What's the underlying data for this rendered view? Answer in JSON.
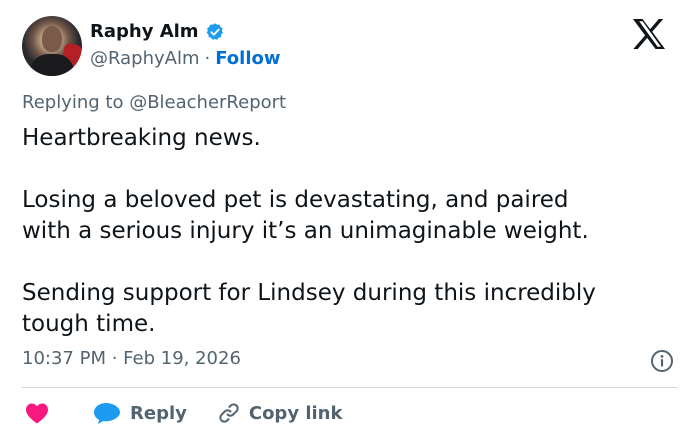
{
  "author": {
    "display_name": "Raphy Alm",
    "handle": "@RaphyAlm",
    "separator": "·",
    "follow_label": "Follow",
    "verified": true
  },
  "reply_to": "Replying to @BleacherReport",
  "tweet_text": "Heartbreaking news.\n\nLosing a beloved pet is devastating, and paired\nwith a serious injury it’s an unimaginable weight.\n\nSending support for Lindsey during this incredibly\ntough time.",
  "timestamp": "10:37 PM · Feb 19, 2026",
  "actions": {
    "reply_label": "Reply",
    "copy_link_label": "Copy link"
  },
  "colors": {
    "verified": "#1d9bf0",
    "follow": "#006fd6",
    "heart": "#f91880",
    "reply_bubble": "#1d9bf0",
    "muted": "#536471"
  },
  "icons": [
    "verified-badge-icon",
    "x-logo-icon",
    "info-icon",
    "heart-icon",
    "reply-bubble-icon",
    "link-icon"
  ]
}
